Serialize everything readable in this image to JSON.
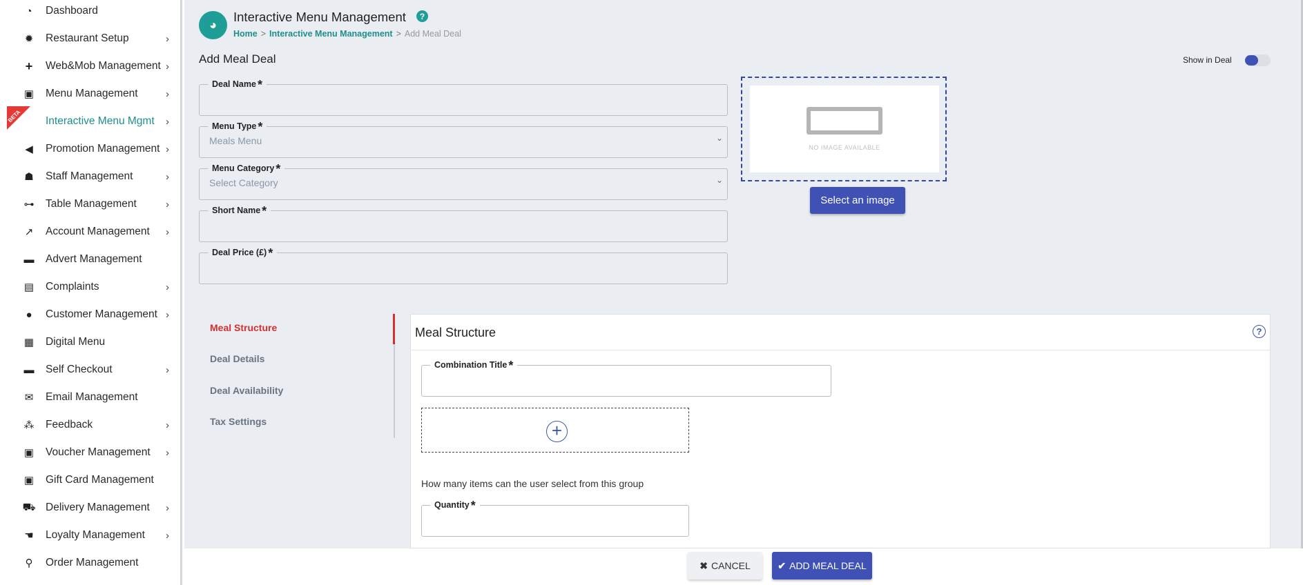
{
  "sidebar": {
    "items": [
      {
        "label": "Dashboard",
        "icon": "dashboard-icon",
        "chevron": ""
      },
      {
        "label": "Restaurant Setup",
        "icon": "gear-icon",
        "chevron": "›"
      },
      {
        "label": "Web&Mob Management",
        "icon": "plus-icon",
        "chevron": "›"
      },
      {
        "label": "Menu Management",
        "icon": "menu-book-icon",
        "chevron": "›"
      },
      {
        "label": "Interactive Menu Mgmt",
        "icon": "",
        "chevron": "›"
      },
      {
        "label": "Promotion Management",
        "icon": "megaphone-icon",
        "chevron": "›"
      },
      {
        "label": "Staff Management",
        "icon": "staff-icon",
        "chevron": "›"
      },
      {
        "label": "Table Management",
        "icon": "table-icon",
        "chevron": "›"
      },
      {
        "label": "Account Management",
        "icon": "chart-icon",
        "chevron": "›"
      },
      {
        "label": "Advert Management",
        "icon": "monitor-icon",
        "chevron": ""
      },
      {
        "label": "Complaints",
        "icon": "document-icon",
        "chevron": "›"
      },
      {
        "label": "Customer Management",
        "icon": "user-icon",
        "chevron": "›"
      },
      {
        "label": "Digital Menu",
        "icon": "grid-icon",
        "chevron": ""
      },
      {
        "label": "Self Checkout",
        "icon": "checkout-icon",
        "chevron": "›"
      },
      {
        "label": "Email Management",
        "icon": "envelope-icon",
        "chevron": ""
      },
      {
        "label": "Feedback",
        "icon": "sitemap-icon",
        "chevron": "›"
      },
      {
        "label": "Voucher Management",
        "icon": "voucher-icon",
        "chevron": "›"
      },
      {
        "label": "Gift Card Management",
        "icon": "gift-card-icon",
        "chevron": ""
      },
      {
        "label": "Delivery Management",
        "icon": "truck-icon",
        "chevron": "›"
      },
      {
        "label": "Loyalty Management",
        "icon": "hand-coin-icon",
        "chevron": "›"
      },
      {
        "label": "Order Management",
        "icon": "waiter-icon",
        "chevron": ""
      }
    ],
    "beta_label": "BETA"
  },
  "header": {
    "title": "Interactive Menu Management",
    "help": "?",
    "breadcrumb": [
      "Home",
      "Interactive Menu Management",
      "Add Meal Deal"
    ],
    "sep": ">"
  },
  "form": {
    "title": "Add Meal Deal",
    "show_in_deal": "Show in Deal",
    "deal_name_label": "Deal Name",
    "menu_type_label": "Menu Type",
    "menu_type_value": "Meals Menu",
    "menu_category_label": "Menu Category",
    "menu_category_value": "Select Category",
    "short_name_label": "Short Name",
    "deal_price_label": "Deal Price (£)",
    "required_mark": "*",
    "no_image_text": "NO IMAGE AVAILABLE",
    "select_image_label": "Select an image"
  },
  "tabs": [
    "Meal Structure",
    "Deal Details",
    "Deal Availability",
    "Tax Settings"
  ],
  "meal_structure": {
    "title": "Meal Structure",
    "help": "?",
    "combination_title_label": "Combination Title",
    "add_symbol": "+",
    "question": "How many items can the user select from this group",
    "quantity_label": "Quantity"
  },
  "footer": {
    "cancel_label": "CANCEL",
    "cancel_icon": "✖",
    "add_label": "ADD MEAL DEAL",
    "add_icon": "✔"
  },
  "colors": {
    "accent": "#3f51b5",
    "teal": "#1e9e97",
    "active_tab": "#d32f2f"
  }
}
